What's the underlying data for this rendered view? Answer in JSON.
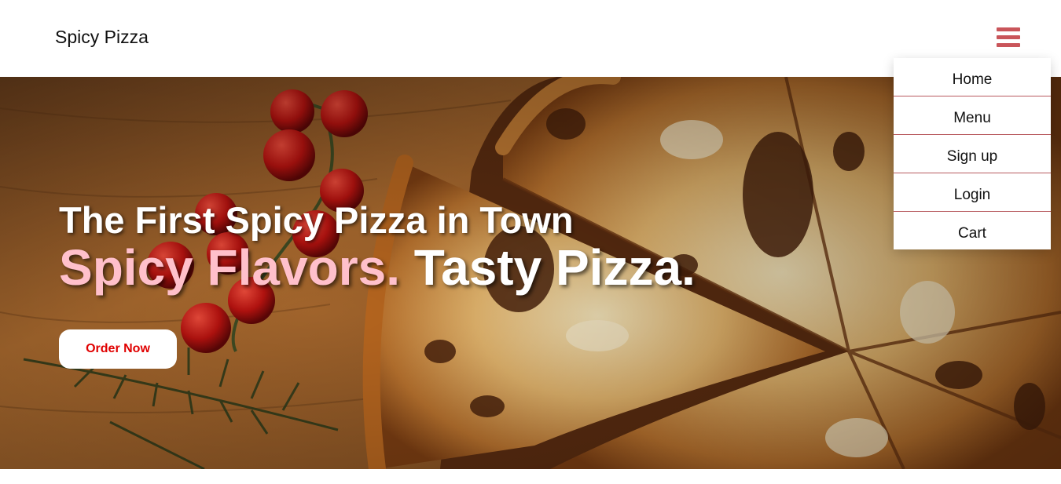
{
  "header": {
    "brand": "Spicy Pizza",
    "menu_icon": "hamburger-menu-icon",
    "menu_color": "#c9555a"
  },
  "hero": {
    "headline": "The First Spicy Pizza in Town",
    "tagline_accent": "Spicy Flavors.",
    "tagline_rest": "Tasty Pizza.",
    "accent_color": "#ffc0cb",
    "cta_label": "Order Now",
    "cta_color": "#e00000",
    "image": "pizza-with-tomatoes-and-rosemary-photo"
  },
  "dropdown": {
    "items": [
      {
        "label": "Home"
      },
      {
        "label": "Menu"
      },
      {
        "label": "Sign up"
      },
      {
        "label": "Login"
      },
      {
        "label": "Cart"
      }
    ],
    "divider_color": "#b85a5f"
  }
}
